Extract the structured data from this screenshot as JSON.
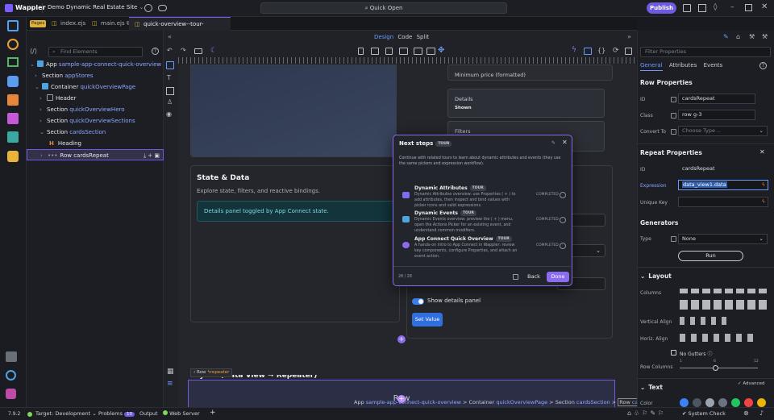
{
  "app": {
    "name": "Wappler",
    "project": "Demo Dynamic Real Estate Site",
    "quick_open": "Quick Open",
    "publish": "Publish"
  },
  "tabs": {
    "pages_badge": "Pages",
    "items": [
      "index.ejs",
      "main.ejs",
      "quick-overview--tour-manual.html"
    ],
    "close": "×"
  },
  "tree": {
    "search_placeholder": "Find Elements",
    "nodes": [
      {
        "kw": "App",
        "nm": "sample-app-connect-quick-overview"
      },
      {
        "kw": "Section",
        "nm": "appStores"
      },
      {
        "kw": "Container",
        "nm": "quickOverviewPage"
      },
      {
        "kw": "Header",
        "nm": ""
      },
      {
        "kw": "Section",
        "nm": "quickOverviewHero"
      },
      {
        "kw": "Section",
        "nm": "quickOverviewSections"
      },
      {
        "kw": "Section",
        "nm": "cardsSection"
      },
      {
        "kw": "Heading",
        "nm": ""
      },
      {
        "kw": "Row",
        "nm": "cardsRepeat"
      }
    ]
  },
  "viewmodes": {
    "design": "Design",
    "code": "Code",
    "split": "Split"
  },
  "canvas": {
    "min_price": "Minimum price (formatted)",
    "details_label": "Details",
    "details_value": "Shown",
    "filters_label": "Filters",
    "state_title": "State & Data",
    "state_sub": "Explore state, filters, and reactive bindings.",
    "alert": "Details panel toggled by App Connect state.",
    "toggle_label": "Show details panel",
    "set_value": "Set Value",
    "row_tag": "Row",
    "repeater_tag": "repeater",
    "partial_heading": "Layout (Data View → Repeater)",
    "row_label": "Row",
    "breadcrumb": [
      {
        "kw": "App",
        "nm": "sample-app-connect-quick-overview"
      },
      {
        "kw": "Container",
        "nm": "quickOverviewPage"
      },
      {
        "kw": "Section",
        "nm": "cardsSection"
      },
      {
        "kw": "Row",
        "nm": "cardsRepeat"
      }
    ]
  },
  "modal": {
    "title": "Next steps",
    "badge": "TOUR",
    "intro": "Continue with related tours to learn about dynamic attributes and events (they use the same pickers and expression workflow).",
    "items": [
      {
        "title": "Dynamic Attributes",
        "badge": "TOUR",
        "desc": "Dynamic Attributes overview: use Properties ( + ) to add attributes, then inspect and bind values with picker icons and valid expressions.",
        "status": "COMPLETED"
      },
      {
        "title": "Dynamic Events",
        "badge": "TOUR",
        "desc": "Dynamic Events overview: preview the ( + ) menu, open the Actions Picker for an existing event, and understand common modifiers.",
        "status": "COMPLETED"
      },
      {
        "title": "App Connect Quick Overview",
        "badge": "TOUR",
        "desc": "A hands-on intro to App Connect in Wappler: review key components, configure Properties, and attach an event action.",
        "status": "COMPLETED"
      }
    ],
    "page": "28 / 28",
    "back": "Back",
    "done": "Done"
  },
  "props": {
    "filter_placeholder": "Filter Properties",
    "tabs": [
      "General",
      "Attributes",
      "Events"
    ],
    "row_props": "Row Properties",
    "id_label": "ID",
    "id_value": "cardsRepeat",
    "class_label": "Class",
    "class_value": "row g-3",
    "convert_label": "Convert To",
    "convert_placeholder": "Choose Type ..",
    "repeat_props": "Repeat Properties",
    "rid_label": "ID",
    "rid_value": "cardsRepeat",
    "expr_label": "Expression",
    "expr_value": "data_view1.data",
    "ukey_label": "Unique Key",
    "generators": "Generators",
    "type_label": "Type",
    "type_value": "None",
    "run": "Run",
    "layout": "Layout",
    "columns_label": "Columns",
    "valign_label": "Vertical Align",
    "halign_label": "Horiz. Align",
    "nogutters": "No Gutters",
    "rowcols_label": "Row Columns",
    "slider_ticks": [
      "1",
      "6",
      "12"
    ],
    "slider_value": 0.45,
    "text": "Text",
    "advanced": "Advanced",
    "color_label": "Color",
    "colors": [
      "#3b82f6",
      "#4b5563",
      "#9ca3af",
      "#6b7280",
      "#22c55e",
      "#ef4444",
      "#eab308"
    ]
  },
  "status": {
    "version": "7.9.2",
    "target": "Target:",
    "target_val": "Development",
    "problems": "Problems",
    "problems_count": "10",
    "output": "Output",
    "web_server": "Web Server",
    "system_check": "System Check"
  }
}
